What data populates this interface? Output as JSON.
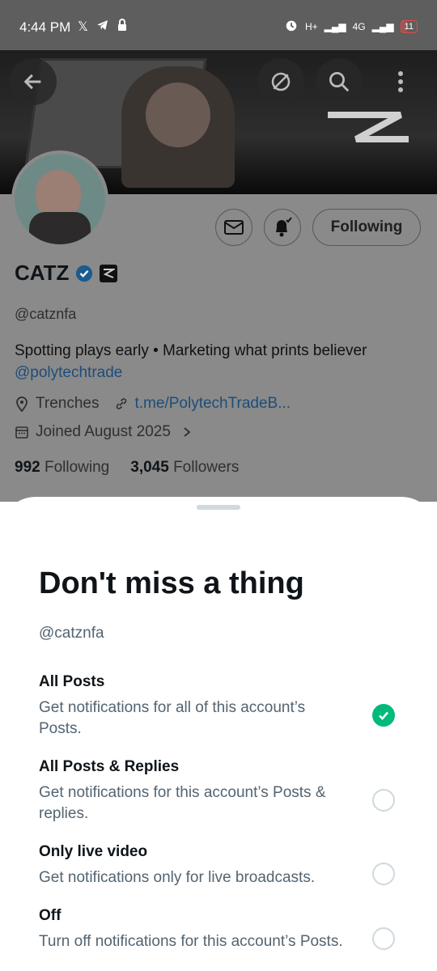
{
  "status_bar": {
    "time": "4:44 PM",
    "left_icons": [
      "x-logo-icon",
      "telegram-icon",
      "lock-icon"
    ],
    "signal_1": "H+",
    "signal_2": "4G",
    "battery": "11"
  },
  "header": {
    "back_icon": "arrow-left-icon",
    "nostr_icon": "nostr-icon",
    "search_icon": "search-icon",
    "more_icon": "more-vertical-icon"
  },
  "profile": {
    "display_name": "CATZ",
    "handle": "@catznfa",
    "bio_text": "Spotting plays early • Marketing what prints believer",
    "bio_link": "@polytechtrade",
    "location": "Trenches",
    "website": "t.me/PolytechTradeB...",
    "joined": "Joined August 2025",
    "following_count": "992",
    "following_label": "Following",
    "followers_count": "3,045",
    "followers_label": "Followers",
    "following_button": "Following"
  },
  "sheet": {
    "title": "Don't miss a thing",
    "handle": "@catznfa",
    "options": [
      {
        "title": "All Posts",
        "description": "Get notifications for all of this account’s Posts.",
        "selected": true
      },
      {
        "title": "All Posts & Replies",
        "description": "Get notifications for this account’s Posts & replies.",
        "selected": false
      },
      {
        "title": "Only live video",
        "description": "Get notifications only for live broadcasts.",
        "selected": false
      },
      {
        "title": "Off",
        "description": "Turn off notifications for this account’s Posts.",
        "selected": false
      }
    ]
  },
  "colors": {
    "accent_selected": "#00ba7c",
    "link": "#1d9bf0",
    "text_secondary": "#536471",
    "overlay": "#5e5e5e"
  }
}
